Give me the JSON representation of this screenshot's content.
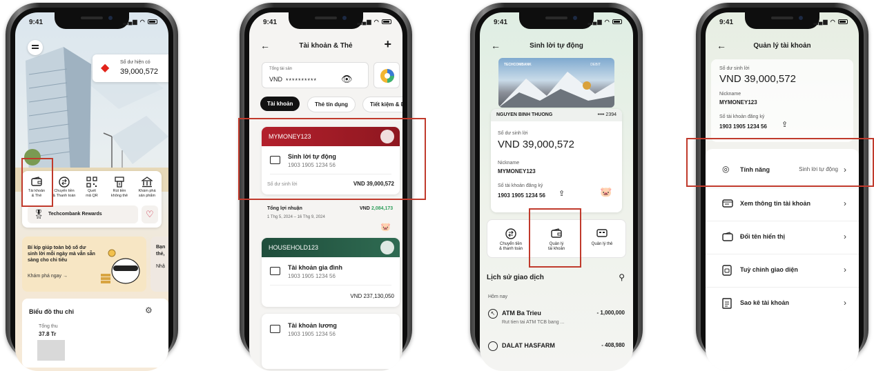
{
  "colors": {
    "accent_red": "#c8102e",
    "dark_green": "#1f4d3b",
    "highlight": "#c0392b"
  },
  "phone1": {
    "time": "9:41",
    "menu_icon": "hamburger-icon",
    "balance_label": "Số dư hiện có",
    "balance_value": "39,000,572",
    "actions": [
      {
        "label": "Tài khoản\n& Thẻ",
        "icon": "wallet-icon"
      },
      {
        "label": "Chuyển tiền\n& Thanh toán",
        "icon": "transfer-icon"
      },
      {
        "label": "Quét\nmã QR",
        "icon": "qr-icon"
      },
      {
        "label": "Rút tiền\nkhông thẻ",
        "icon": "cash-icon"
      },
      {
        "label": "Khám phá\nsản phẩm",
        "icon": "bank-icon"
      }
    ],
    "rewards_label": "Techcombank Rewards",
    "promo_text": "Bí kíp giúp toàn bộ số dư sinh lời mỗi ngày mà vẫn sẵn sàng cho chi tiêu",
    "promo_link": "Khám phá ngay →",
    "promo2_text_line1": "Bạn",
    "promo2_text_line2": "thẻ,",
    "promo2_text_line3": "Nhậ",
    "chart_title": "Biểu đồ thu chi",
    "income_label": "Tổng thu",
    "income_value": "37.8 Tr"
  },
  "phone2": {
    "time": "9:41",
    "title": "Tài khoản & Thẻ",
    "total_label": "Tổng tài sản",
    "total_currency": "VND",
    "total_masked": "**********",
    "tabs": [
      "Tài khoản",
      "Thẻ tín dụng",
      "Tiết kiệm & Đ"
    ],
    "card1": {
      "name": "MYMONEY123",
      "account_title": "Sinh lời tự động",
      "account_number": "1903 1905 1234 56",
      "balance_label": "Số dư sinh lời",
      "balance_value": "VND 39,000,572"
    },
    "profit_label": "Tổng lợi nhuận",
    "profit_currency": "VND",
    "profit_value": "2,084,173",
    "profit_period": "1 Thg 5, 2024 – 16 Thg 9, 2024",
    "card2": {
      "name": "HOUSEHOLD123",
      "account_title": "Tài khoản gia đình",
      "account_number": "1903 1905 1234 56",
      "balance_value": "VND 237,130,050"
    },
    "card3": {
      "account_title": "Tài khoản lương",
      "account_number": "1903 1905 1234 56"
    }
  },
  "phone3": {
    "time": "9:41",
    "title": "Sinh lời tự động",
    "card_brand": "TECHCOMBANK",
    "card_type": "DEBIT",
    "holder": "NGUYEN BINH THUONG",
    "card_last": "•••• 2394",
    "balance_label": "Số dư sinh lời",
    "balance_value": "VND 39,000,572",
    "nickname_label": "Nickname",
    "nickname": "MYMONEY123",
    "reg_label": "Số tài khoản đăng ký",
    "reg_number": "1903 1905 1234 56",
    "actions": [
      {
        "label": "Chuyển tiền\n& thanh toán",
        "icon": "transfer-icon"
      },
      {
        "label": "Quản lý\ntài khoản",
        "icon": "wallet-icon"
      },
      {
        "label": "Quản lý thẻ",
        "icon": "card-icon"
      }
    ],
    "history_title": "Lịch sử giao dịch",
    "today_label": "Hôm nay",
    "tx1_name": "ATM Ba Trieu",
    "tx1_desc": "Rut tien tai ATM TCB bang ...",
    "tx1_amount": "- 1,000,000",
    "tx2_name": "DALAT HASFARM",
    "tx2_amount": "- 408,980"
  },
  "phone4": {
    "time": "9:41",
    "title": "Quản lý tài khoản",
    "balance_label": "Số dư sinh lời",
    "balance_value": "VND 39,000,572",
    "nickname_label": "Nickname",
    "nickname": "MYMONEY123",
    "reg_label": "Số tài khoản đăng ký",
    "reg_number": "1903 1905 1234 56",
    "feature_label": "Tính năng",
    "feature_value": "Sinh lời tự động",
    "menu": [
      {
        "label": "Xem thông tin tài khoản",
        "icon": "info-card-icon"
      },
      {
        "label": "Đổi tên hiển thị",
        "icon": "rename-icon"
      },
      {
        "label": "Tuỳ chỉnh giao diện",
        "icon": "customize-icon"
      },
      {
        "label": "Sao kê tài khoản",
        "icon": "statement-icon"
      }
    ]
  }
}
